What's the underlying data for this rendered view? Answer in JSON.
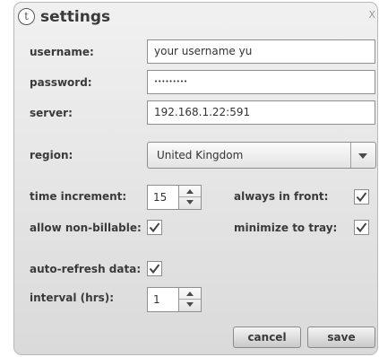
{
  "window": {
    "title": "settings",
    "logo_letter": "t",
    "close_label": "X"
  },
  "fields": {
    "username": {
      "label": "username:",
      "value": "your username yu"
    },
    "password": {
      "label": "password:",
      "value": "•••••••••"
    },
    "server": {
      "label": "server:",
      "value": "192.168.1.22:591"
    }
  },
  "region": {
    "label": "region:",
    "selected": "United Kingdom"
  },
  "time_increment": {
    "label": "time increment:",
    "value": "15"
  },
  "always_in_front": {
    "label": "always in front:",
    "checked": true
  },
  "allow_non_billable": {
    "label": "allow non-billable:",
    "checked": true
  },
  "minimize_to_tray": {
    "label": "minimize to tray:",
    "checked": true
  },
  "auto_refresh": {
    "label": "auto-refresh data:",
    "checked": true
  },
  "interval": {
    "label": "interval (hrs):",
    "value": "1"
  },
  "buttons": {
    "cancel": "cancel",
    "save": "save"
  }
}
